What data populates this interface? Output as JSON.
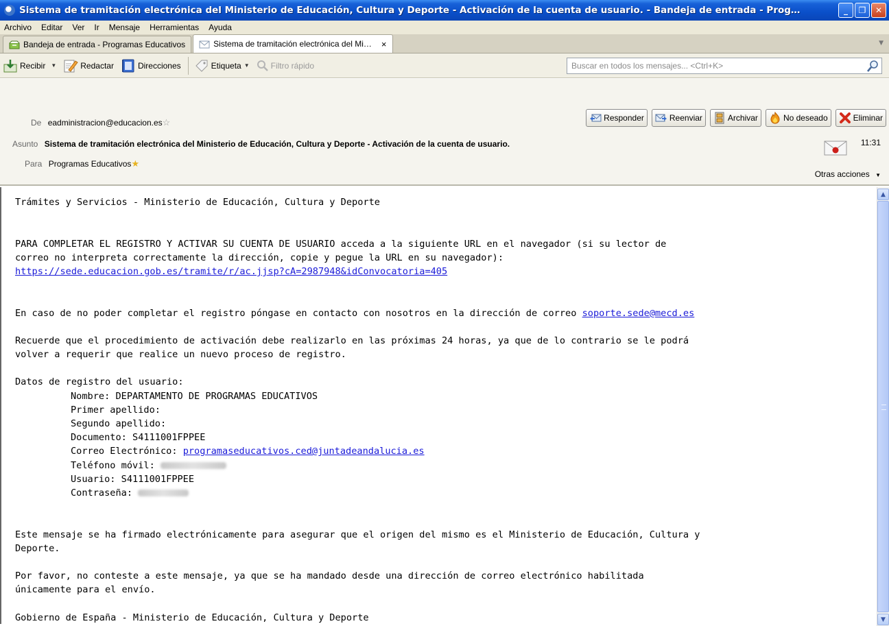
{
  "window": {
    "title": "Sistema de tramitación electrónica del Ministerio de Educación, Cultura y Deporte - Activación de la cuenta de usuario. - Bandeja de entrada - Prog…"
  },
  "menu": {
    "items": [
      "Archivo",
      "Editar",
      "Ver",
      "Ir",
      "Mensaje",
      "Herramientas",
      "Ayuda"
    ]
  },
  "tabs": [
    {
      "label": "Bandeja de entrada - Programas Educativos"
    },
    {
      "label": "Sistema de tramitación electrónica del Mi…",
      "close": "×"
    }
  ],
  "toolbar": {
    "receive": "Recibir",
    "compose": "Redactar",
    "addresses": "Direcciones",
    "tag": "Etiqueta",
    "quick_filter": "Filtro rápido",
    "search_placeholder": "Buscar en todos los mensajes... <Ctrl+K>"
  },
  "header": {
    "from_label": "De",
    "from_value": "eadministracion@educacion.es",
    "subject_label": "Asunto",
    "subject_value": "Sistema de tramitación electrónica del Ministerio de Educación, Cultura y Deporte - Activación de la cuenta de usuario.",
    "to_label": "Para",
    "to_value": "Programas Educativos",
    "time": "11:31",
    "more_actions": "Otras acciones",
    "buttons": {
      "reply": "Responder",
      "forward": "Reenviar",
      "archive": "Archivar",
      "junk": "No deseado",
      "delete": "Eliminar"
    }
  },
  "body": {
    "line1": "Trámites y Servicios - Ministerio de Educación, Cultura y Deporte",
    "line2": "PARA COMPLETAR EL REGISTRO Y ACTIVAR SU CUENTA DE USUARIO acceda a la siguiente URL en el navegador (si su lector de",
    "line3": "correo no interpreta correctamente la dirección, copie y pegue la URL en su navegador):",
    "url": "https://sede.educacion.gob.es/tramite/r/ac.jjsp?cA=2987948&idConvocatoria=405",
    "contact_text": "En caso de no poder completar el registro póngase en contacto con nosotros en la dirección de correo ",
    "contact_email": "soporte.sede@mecd.es",
    "reminder1": "Recuerde que el procedimiento de activación debe realizarlo en las próximas 24 horas, ya que de lo contrario se le podrá",
    "reminder2": "volver a requerir que realice un nuevo proceso de registro.",
    "data_title": "Datos de registro del usuario:",
    "nombre": "Nombre: DEPARTAMENTO DE PROGRAMAS EDUCATIVOS",
    "primer": "Primer apellido:",
    "segundo": "Segundo apellido:",
    "documento": "Documento: S4111001FPPEE",
    "correo_label": "Correo Electrónico: ",
    "correo_value": "programaseducativos.ced@juntadeandalucia.es",
    "telefono": "Teléfono móvil:",
    "usuario": "Usuario: S4111001FPPEE",
    "contrasena": "Contraseña:",
    "signed1": "Este mensaje se ha firmado electrónicamente para asegurar que el origen del mismo es el Ministerio de Educación, Cultura y",
    "signed2": "Deporte.",
    "noreply1": "Por favor, no conteste a este mensaje, ya que se ha mandado desde una dirección de correo electrónico habilitada",
    "noreply2": "únicamente para el envío.",
    "footer": "Gobierno de España - Ministerio de Educación, Cultura y Deporte"
  },
  "colors": {
    "titlebar": "#0a4fc9",
    "link": "#1a1ad8",
    "chrome": "#ece9d8"
  }
}
